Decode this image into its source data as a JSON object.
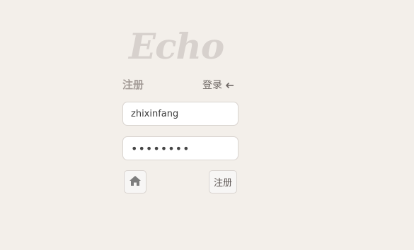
{
  "app": {
    "logo_text": "Echo"
  },
  "form": {
    "heading": "注册",
    "login_link_label": "登录",
    "username_value": "zhixinfang",
    "password_value": "••••••••",
    "submit_label": "注册"
  },
  "icons": {
    "login_arrow": "arrow-left-icon",
    "home_button": "home-icon"
  },
  "colors": {
    "background": "#f3efea",
    "logo": "#d7d1cd",
    "heading": "#a39b97",
    "icon": "#7d7d7d"
  }
}
